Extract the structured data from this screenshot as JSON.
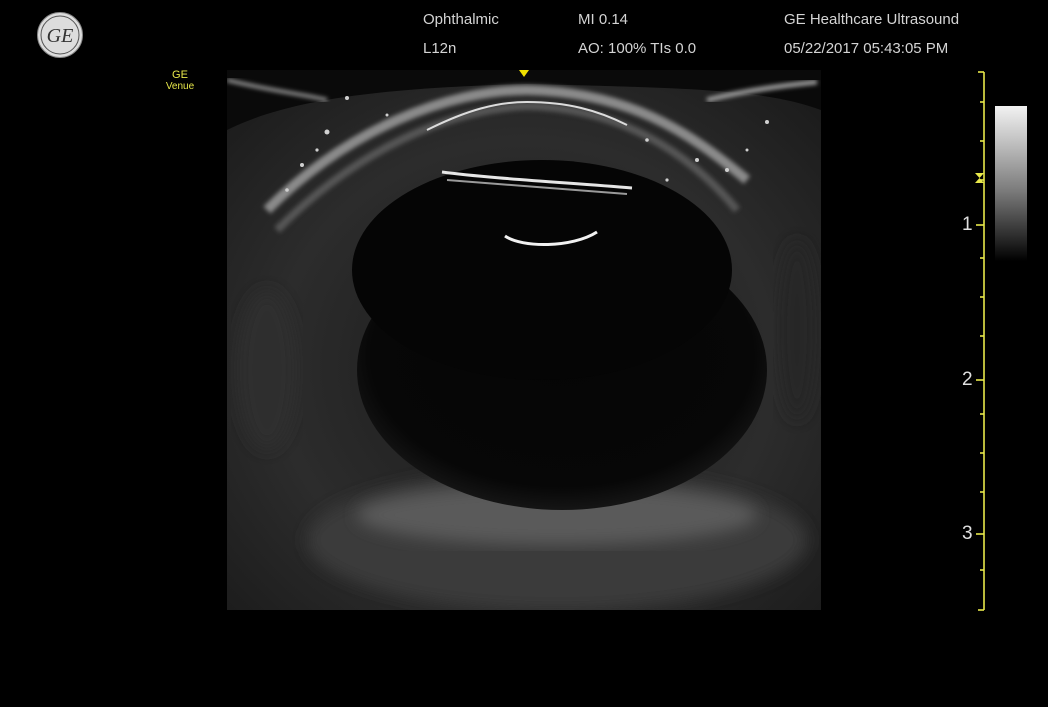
{
  "header": {
    "preset": "Ophthalmic",
    "probe": "L12n",
    "mi": "MI 0.14",
    "ao_tis": "AO: 100% TIs 0.0",
    "vendor": "GE Healthcare Ultrasound",
    "datetime": "05/22/2017 05:43:05 PM"
  },
  "logo": {
    "brand": "GE",
    "model_line1": "GE",
    "model_line2": "Venue"
  },
  "depth_scale": {
    "labels": [
      "1",
      "2",
      "3"
    ],
    "unit_ticks_color": "#e8e84a"
  },
  "colors": {
    "accent": "#e8e84a",
    "focus_marker": "#f0e000",
    "background": "#000000"
  },
  "icons": {
    "logo": "ge-monogram-icon",
    "focus": "triangle-down-icon",
    "focus_zone": "hourglass-icon"
  }
}
